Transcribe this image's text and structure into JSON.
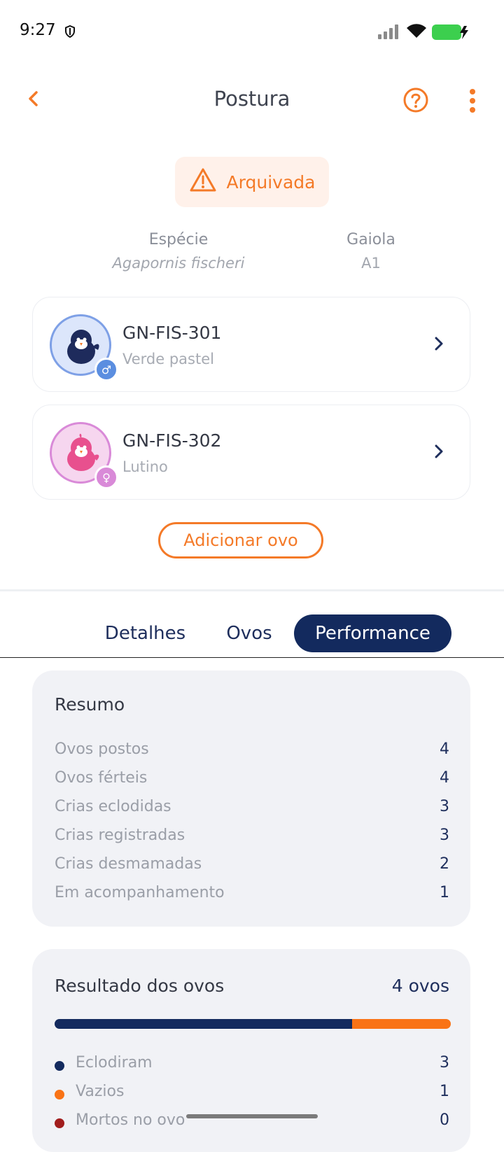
{
  "status_bar": {
    "time": "9:27"
  },
  "header": {
    "title": "Postura"
  },
  "status_badge": {
    "label": "Arquivada"
  },
  "meta": {
    "species_label": "Espécie",
    "species_value": "Agapornis fischeri",
    "cage_label": "Gaiola",
    "cage_value": "A1"
  },
  "birds": [
    {
      "id": "GN-FIS-301",
      "mutation": "Verde pastel",
      "sex": "male",
      "sex_symbol": "♂"
    },
    {
      "id": "GN-FIS-302",
      "mutation": "Lutino",
      "sex": "female",
      "sex_symbol": "♀"
    }
  ],
  "add_egg_button": "Adicionar ovo",
  "tabs": [
    {
      "label": "Detalhes",
      "active": false
    },
    {
      "label": "Ovos",
      "active": false
    },
    {
      "label": "Performance",
      "active": true
    }
  ],
  "summary": {
    "title": "Resumo",
    "rows": [
      {
        "label": "Ovos postos",
        "value": "4"
      },
      {
        "label": "Ovos férteis",
        "value": "4"
      },
      {
        "label": "Crias eclodidas",
        "value": "3"
      },
      {
        "label": "Crias registradas",
        "value": "3"
      },
      {
        "label": "Crias desmamadas",
        "value": "2"
      },
      {
        "label": "Em acompanhamento",
        "value": "1"
      }
    ]
  },
  "egg_results": {
    "title": "Resultado dos ovos",
    "total": "4 ovos",
    "segments": [
      {
        "label": "Eclodiram",
        "value": 3,
        "color": "#132a5e"
      },
      {
        "label": "Vazios",
        "value": 1,
        "color": "#f97316"
      },
      {
        "label": "Mortos no ovo",
        "value": 0,
        "color": "#a11d1d"
      }
    ]
  },
  "colors": {
    "accent": "#f47a28",
    "navy": "#132a5e",
    "male": "#5b8ee0",
    "female": "#d98ad8"
  }
}
